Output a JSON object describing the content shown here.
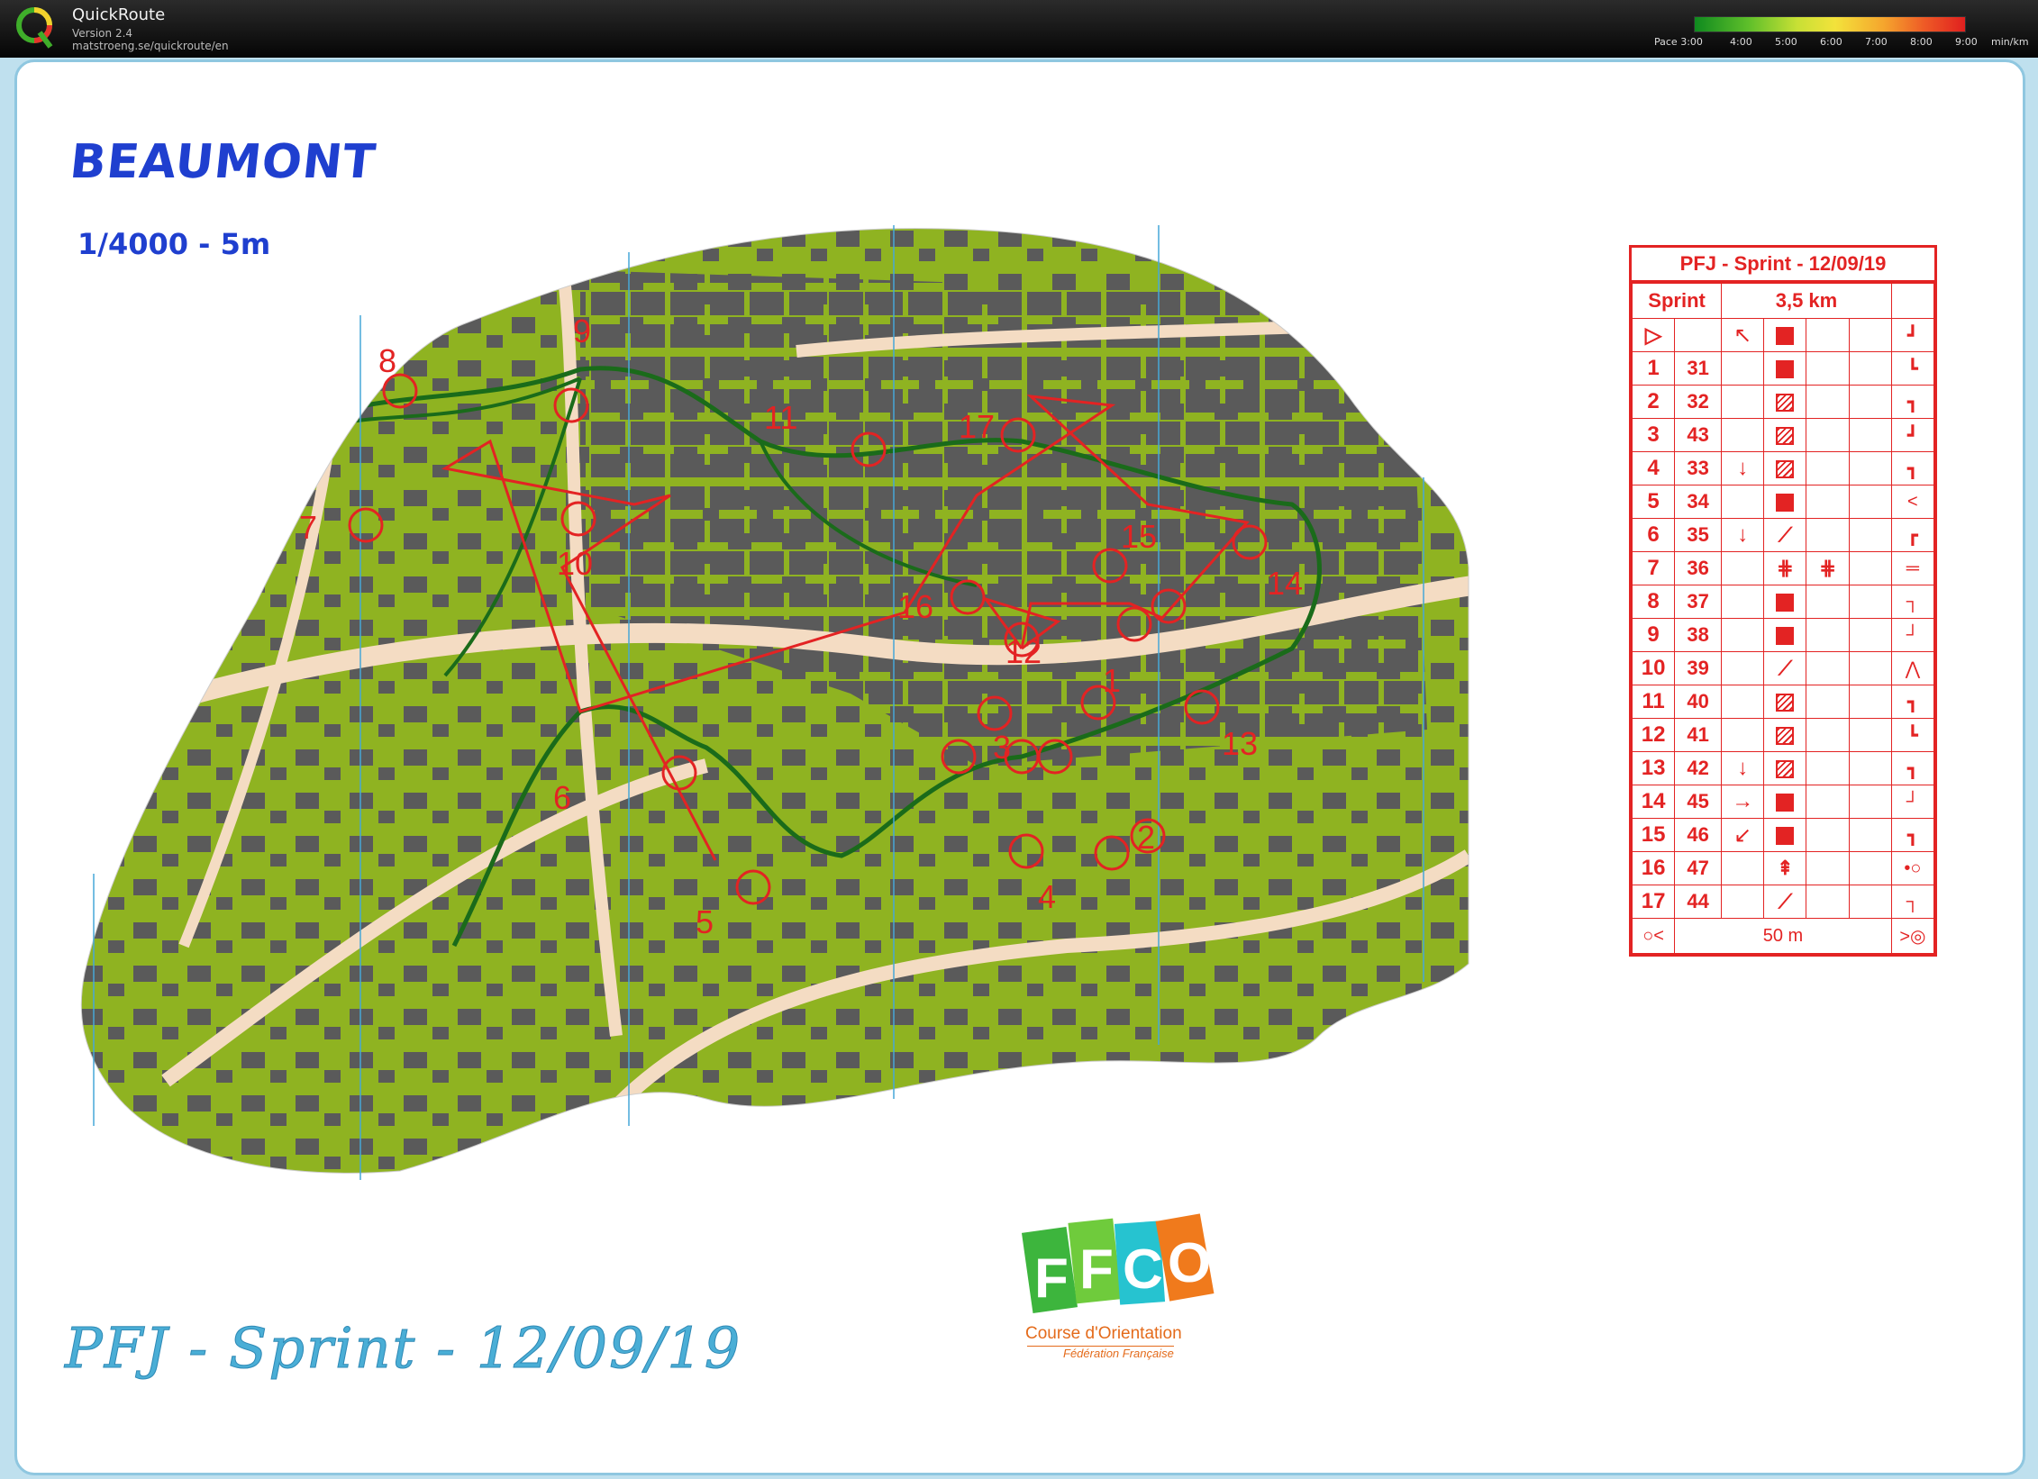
{
  "app": {
    "name": "QuickRoute",
    "version": "Version 2.4",
    "url": "matstroeng.se/quickroute/en"
  },
  "pace_legend": {
    "labels": [
      "Pace 3:00",
      "4:00",
      "5:00",
      "6:00",
      "7:00",
      "8:00",
      "9:00",
      "min/km"
    ],
    "colors": [
      "#0f8a1f",
      "#c8e035",
      "#f3e23b",
      "#f5a52d",
      "#e0201f"
    ]
  },
  "map": {
    "title": "BEAUMONT",
    "scale": "1/4000 - 5m",
    "bottom_title": "PFJ - Sprint - 12/09/19",
    "control_numbers": [
      "7",
      "8",
      "9",
      "10",
      "11",
      "17",
      "15",
      "16",
      "14",
      "12",
      "1",
      "3",
      "13",
      "6",
      "5",
      "4",
      "2"
    ],
    "colors": {
      "course": "#e32323",
      "route": "#1a6b1a",
      "building": "#5a5a5a",
      "vegetation": "#8fb321",
      "paved": "#f4dcc3"
    }
  },
  "logo": {
    "letters": [
      "F",
      "F",
      "C",
      "O"
    ],
    "name": "Course d'Orientation",
    "federation": "Fédération Française"
  },
  "control_description": {
    "title": "PFJ - Sprint - 12/09/19",
    "header": {
      "class": "Sprint",
      "length": "3,5 km"
    },
    "rows": [
      {
        "num": "1",
        "code": "31",
        "dir": "",
        "feat": "square",
        "loc": "┗"
      },
      {
        "num": "2",
        "code": "32",
        "dir": "",
        "feat": "hatch",
        "loc": "┓"
      },
      {
        "num": "3",
        "code": "43",
        "dir": "",
        "feat": "hatch",
        "loc": "┛"
      },
      {
        "num": "4",
        "code": "33",
        "dir": "↓",
        "feat": "hatch",
        "loc": "┓"
      },
      {
        "num": "5",
        "code": "34",
        "dir": "",
        "feat": "square",
        "loc": "<"
      },
      {
        "num": "6",
        "code": "35",
        "dir": "↓",
        "feat": "slope",
        "loc": "┏"
      },
      {
        "num": "7",
        "code": "36",
        "dir": "",
        "feat": "grid",
        "loc": "═"
      },
      {
        "num": "8",
        "code": "37",
        "dir": "",
        "feat": "square",
        "loc": "┐"
      },
      {
        "num": "9",
        "code": "38",
        "dir": "",
        "feat": "square",
        "loc": "┘"
      },
      {
        "num": "10",
        "code": "39",
        "dir": "",
        "feat": "slope",
        "loc": "⋀"
      },
      {
        "num": "11",
        "code": "40",
        "dir": "",
        "feat": "hatch",
        "loc": "┓"
      },
      {
        "num": "12",
        "code": "41",
        "dir": "",
        "feat": "hatch",
        "loc": "┗"
      },
      {
        "num": "13",
        "code": "42",
        "dir": "↓",
        "feat": "hatch",
        "loc": "┓"
      },
      {
        "num": "14",
        "code": "45",
        "dir": "→",
        "feat": "square",
        "loc": "┘"
      },
      {
        "num": "15",
        "code": "46",
        "dir": "↙",
        "feat": "square",
        "loc": "┓"
      },
      {
        "num": "16",
        "code": "47",
        "dir": "",
        "feat": "tree",
        "loc": "•○"
      },
      {
        "num": "17",
        "code": "44",
        "dir": "",
        "feat": "line",
        "loc": "┐"
      }
    ],
    "start": {
      "dir": "↖",
      "loc": "┛"
    },
    "finish_distance": "50 m"
  }
}
